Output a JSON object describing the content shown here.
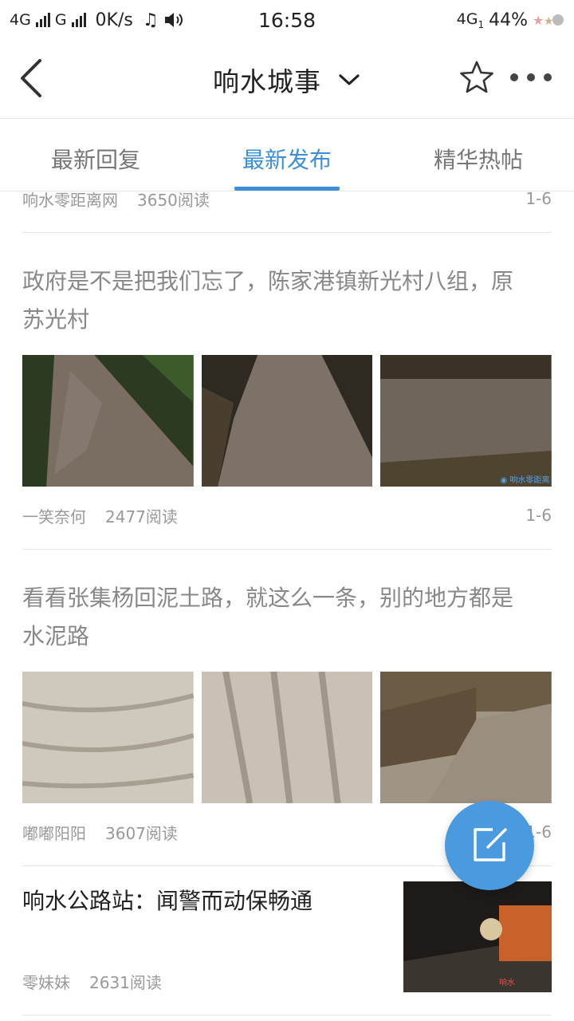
{
  "status_bar": {
    "network1": "4G",
    "network2": "G",
    "speed": "0K/s",
    "time": "16:58",
    "network_right": "4G",
    "network_right_sub": "1",
    "battery": "44%"
  },
  "nav": {
    "title": "响水城事",
    "icons": {
      "back": "back-icon",
      "dropdown": "chevron-down-icon",
      "favorite": "star-icon",
      "more": "more-icon"
    }
  },
  "tabs": [
    {
      "label": "最新回复",
      "active": false
    },
    {
      "label": "最新发布",
      "active": true
    },
    {
      "label": "精华热帖",
      "active": false
    }
  ],
  "posts": [
    {
      "author": "响水零距离网",
      "reads": "3650阅读",
      "pages": "1-6"
    },
    {
      "title": "政府是不是把我们忘了，陈家港镇新光村八组，原苏光村",
      "author": "一笑奈何",
      "reads": "2477阅读",
      "pages": "1-6"
    },
    {
      "title": "看看张集杨回泥土路，就这么一条，别的地方都是水泥路",
      "author": "嘟嘟阳阳",
      "reads": "3607阅读",
      "pages": "1-6"
    },
    {
      "title": "响水公路站：闻警而动保畅通",
      "author": "零妹妹",
      "reads": "2631阅读"
    }
  ],
  "fab": {
    "icon": "compose-icon"
  },
  "colors": {
    "accent": "#3d8fd8",
    "fab": "#4a9ae0",
    "muted_text": "#999999"
  }
}
